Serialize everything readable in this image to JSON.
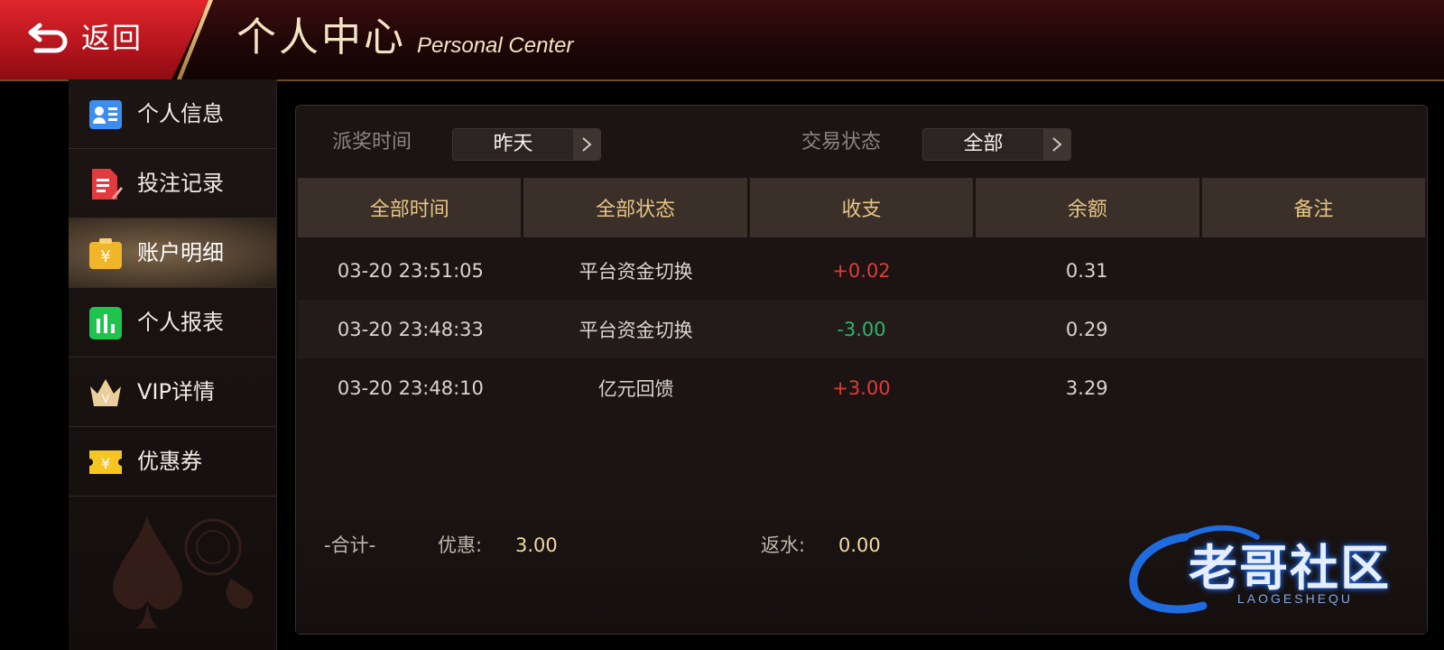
{
  "header": {
    "back_label": "返回",
    "title": "个人中心",
    "subtitle": "Personal Center"
  },
  "sidebar": {
    "items": [
      {
        "label": "个人信息",
        "icon": "id-card-icon"
      },
      {
        "label": "投注记录",
        "icon": "bet-record-icon"
      },
      {
        "label": "账户明细",
        "icon": "wallet-icon",
        "active": true
      },
      {
        "label": "个人报表",
        "icon": "bar-chart-icon"
      },
      {
        "label": "VIP详情",
        "icon": "crown-icon"
      },
      {
        "label": "优惠券",
        "icon": "coupon-icon"
      }
    ]
  },
  "filters": {
    "time_label": "派奖时间",
    "time_value": "昨天",
    "status_label": "交易状态",
    "status_value": "全部"
  },
  "table": {
    "headers": [
      "全部时间",
      "全部状态",
      "收支",
      "余额",
      "备注"
    ],
    "rows": [
      {
        "time": "03-20 23:51:05",
        "status": "平台资金切换",
        "amount": "+0.02",
        "balance": "0.31",
        "note": ""
      },
      {
        "time": "03-20 23:48:33",
        "status": "平台资金切换",
        "amount": "-3.00",
        "balance": "0.29",
        "note": ""
      },
      {
        "time": "03-20 23:48:10",
        "status": "亿元回馈",
        "amount": "+3.00",
        "balance": "3.29",
        "note": ""
      }
    ]
  },
  "summary": {
    "total_label": "-合计-",
    "discount_label": "优惠:",
    "discount_value": "3.00",
    "rebate_label": "返水:",
    "rebate_value": "0.00"
  },
  "watermark": {
    "text": "老哥社区",
    "sub": "LAOGESHEQU"
  },
  "colors": {
    "accent_red": "#d41b22",
    "gold": "#e8c483",
    "positive": "#e03b3b",
    "negative": "#2fb36e"
  }
}
